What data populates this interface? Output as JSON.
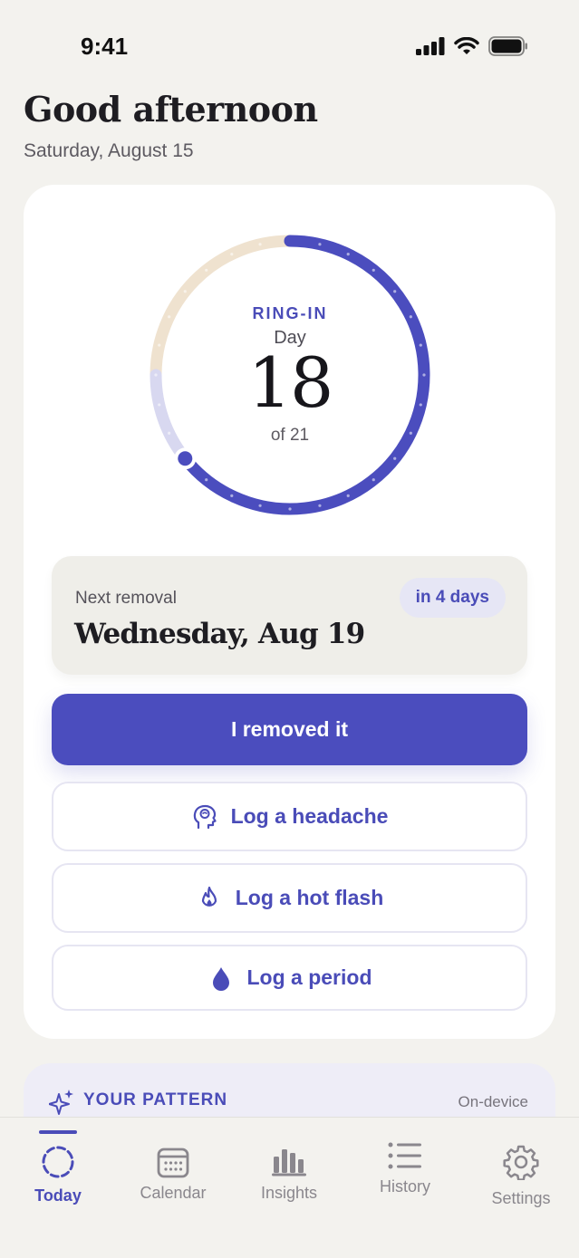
{
  "status_bar": {
    "time": "9:41"
  },
  "header": {
    "greeting": "Good afternoon",
    "date": "Saturday, August 15"
  },
  "cycle": {
    "phase": "RING-IN",
    "day_word": "Day",
    "day": "18",
    "of_total": "of 21",
    "total_days": 21,
    "colors": {
      "ring_in": "#4B4DBE",
      "ring_free": "#EFE2CF",
      "upcoming": "#D8D8F0"
    }
  },
  "next_removal": {
    "label": "Next removal",
    "date": "Wednesday, Aug 19",
    "badge": "in 4 days"
  },
  "actions": {
    "primary": "I removed it",
    "headache": "Log a headache",
    "hot_flash": "Log a hot flash",
    "period": "Log a period"
  },
  "pattern": {
    "title": "YOUR PATTERN",
    "note": "On-device"
  },
  "tabs": [
    {
      "label": "Today",
      "icon": "today-icon",
      "active": true
    },
    {
      "label": "Calendar",
      "icon": "calendar-icon",
      "active": false
    },
    {
      "label": "Insights",
      "icon": "bar-chart-icon",
      "active": false
    },
    {
      "label": "History",
      "icon": "list-icon",
      "active": false
    },
    {
      "label": "Settings",
      "icon": "gear-icon",
      "active": false
    }
  ],
  "colors": {
    "accent": "#4B4DBE",
    "background": "#F3F2EE"
  }
}
